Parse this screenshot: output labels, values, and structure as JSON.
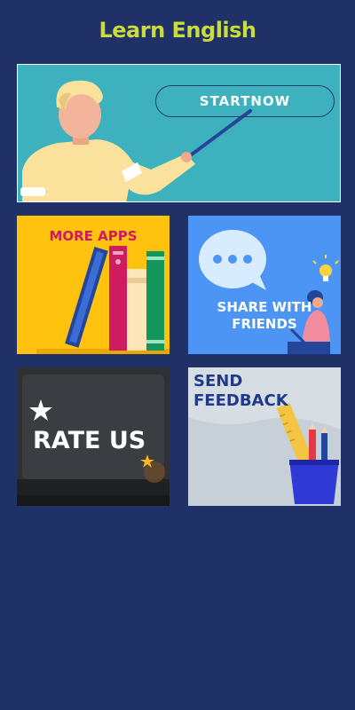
{
  "app": {
    "title": "Learn English",
    "title_color": "#c8dc3c",
    "background": "#1f3166"
  },
  "hero": {
    "button_label": "STARTNOW",
    "bg": "#3eb1bf"
  },
  "tiles": {
    "more_apps": {
      "label": "MORE APPS",
      "bg": "#ffc20e",
      "label_color": "#d11a5e"
    },
    "share": {
      "label_line1": "SHARE WITH",
      "label_line2": "FRIENDS",
      "bg": "#4d95f5"
    },
    "rate": {
      "label": "RATE US",
      "bg": "#2f3134"
    },
    "feedback": {
      "label_line1": "SEND",
      "label_line2": "FEEDBACK",
      "bg": "#d6dde3",
      "label_color": "#1f3a8a"
    }
  },
  "icons": [
    "teacher-illustration",
    "books-illustration",
    "chat-bubble-icon",
    "lightbulb-icon",
    "star-icon",
    "pencil-cup-illustration"
  ]
}
